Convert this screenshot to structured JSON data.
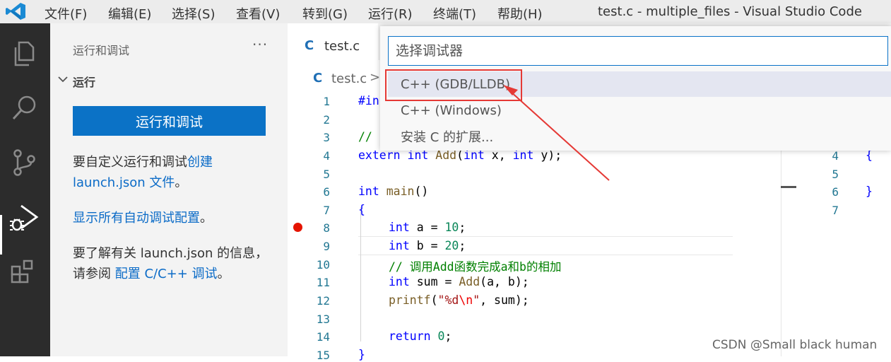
{
  "titlebar": {
    "menu": [
      "文件(F)",
      "编辑(E)",
      "选择(S)",
      "查看(V)",
      "转到(G)",
      "运行(R)",
      "终端(T)",
      "帮助(H)"
    ],
    "window_title": "test.c - multiple_files - Visual Studio Code"
  },
  "activity_bar": {
    "icons": [
      "explorer-icon",
      "search-icon",
      "source-control-icon",
      "run-debug-icon",
      "extensions-icon"
    ],
    "active": "run-debug-icon"
  },
  "sidebar": {
    "title": "运行和调试",
    "more": "···",
    "section_title": "运行",
    "run_button": "运行和调试",
    "p1_text": "要自定义运行和调试",
    "p1_link": "创建 launch.json 文件",
    "p1_end": "。",
    "p2_link": "显示所有自动调试配置",
    "p2_end": "。",
    "p3_text": "要了解有关 launch.json 的信息，请参阅 ",
    "p3_link": "配置 C/C++ 调试",
    "p3_end": "。"
  },
  "editor": {
    "tab_icon": "C",
    "tab_label": "test.c",
    "breadcrumb_icon": "C",
    "breadcrumb_file": "test.c",
    "breadcrumb_sep": ">",
    "line_numbers": [
      "1",
      "2",
      "3",
      "4",
      "5",
      "6",
      "7",
      "8",
      "9",
      "10",
      "11",
      "12",
      "13",
      "14",
      "15"
    ],
    "code": {
      "l1": "#in",
      "l3": "//",
      "l4_kw": "extern",
      "l4_type": "int",
      "l4_fn": "Add",
      "l4_rest1": "(",
      "l4_t1": "int",
      "l4_rest2": " x, ",
      "l4_t2": "int",
      "l4_rest3": " y);",
      "l6_type": "int",
      "l6_fn": "main",
      "l6_rest": "()",
      "l7": "{",
      "l8_type": "int",
      "l8_rest": " a = ",
      "l8_num": "10",
      "l8_end": ";",
      "l9_type": "int",
      "l9_rest": " b = ",
      "l9_num": "20",
      "l9_end": ";",
      "l10": "// 调用Add函数完成a和b的相加",
      "l11_type": "int",
      "l11_rest": " sum = ",
      "l11_fn": "Add",
      "l11_end": "(a, b);",
      "l12_fn": "printf",
      "l12_open": "(",
      "l12_str1": "\"%d",
      "l12_esc": "\\n",
      "l12_str2": "\"",
      "l12_end": ", sum);",
      "l14_kw": "return",
      "l14_num": "0",
      "l14_end": ";",
      "l15": "}"
    },
    "peek_line_numbers": [
      "4",
      "5",
      "6",
      "7"
    ],
    "peek_code": [
      "{",
      "",
      "}",
      ""
    ]
  },
  "quick_pick": {
    "placeholder": "选择调试器",
    "items": [
      "C++ (GDB/LLDB)",
      "C++ (Windows)",
      "安装 C 的扩展..."
    ],
    "selected_index": 0
  },
  "watermark": "CSDN @Small black human",
  "colors": {
    "accent": "#0b72c6",
    "activity_bar": "#2c2c2c",
    "annotation": "#e53935",
    "breakpoint": "#e51400"
  }
}
